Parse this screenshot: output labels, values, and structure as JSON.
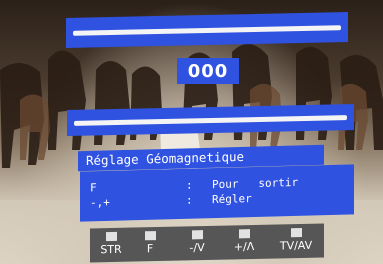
{
  "osd": {
    "value": "000",
    "title": "Réglage Géomagnetique",
    "help": [
      {
        "key": "F",
        "sep": ":",
        "action": "Pour   sortir"
      },
      {
        "key": "-,+",
        "sep": ":",
        "action": "Régler"
      }
    ],
    "keys": [
      {
        "label": "STR"
      },
      {
        "label": "F"
      },
      {
        "label": "-/V"
      },
      {
        "label": "+/Λ"
      },
      {
        "label": "TV/AV"
      }
    ]
  },
  "colors": {
    "osd_blue": "#2f52e0",
    "bar_line": "#f4f4f4",
    "keybar_gray": "#565656"
  }
}
